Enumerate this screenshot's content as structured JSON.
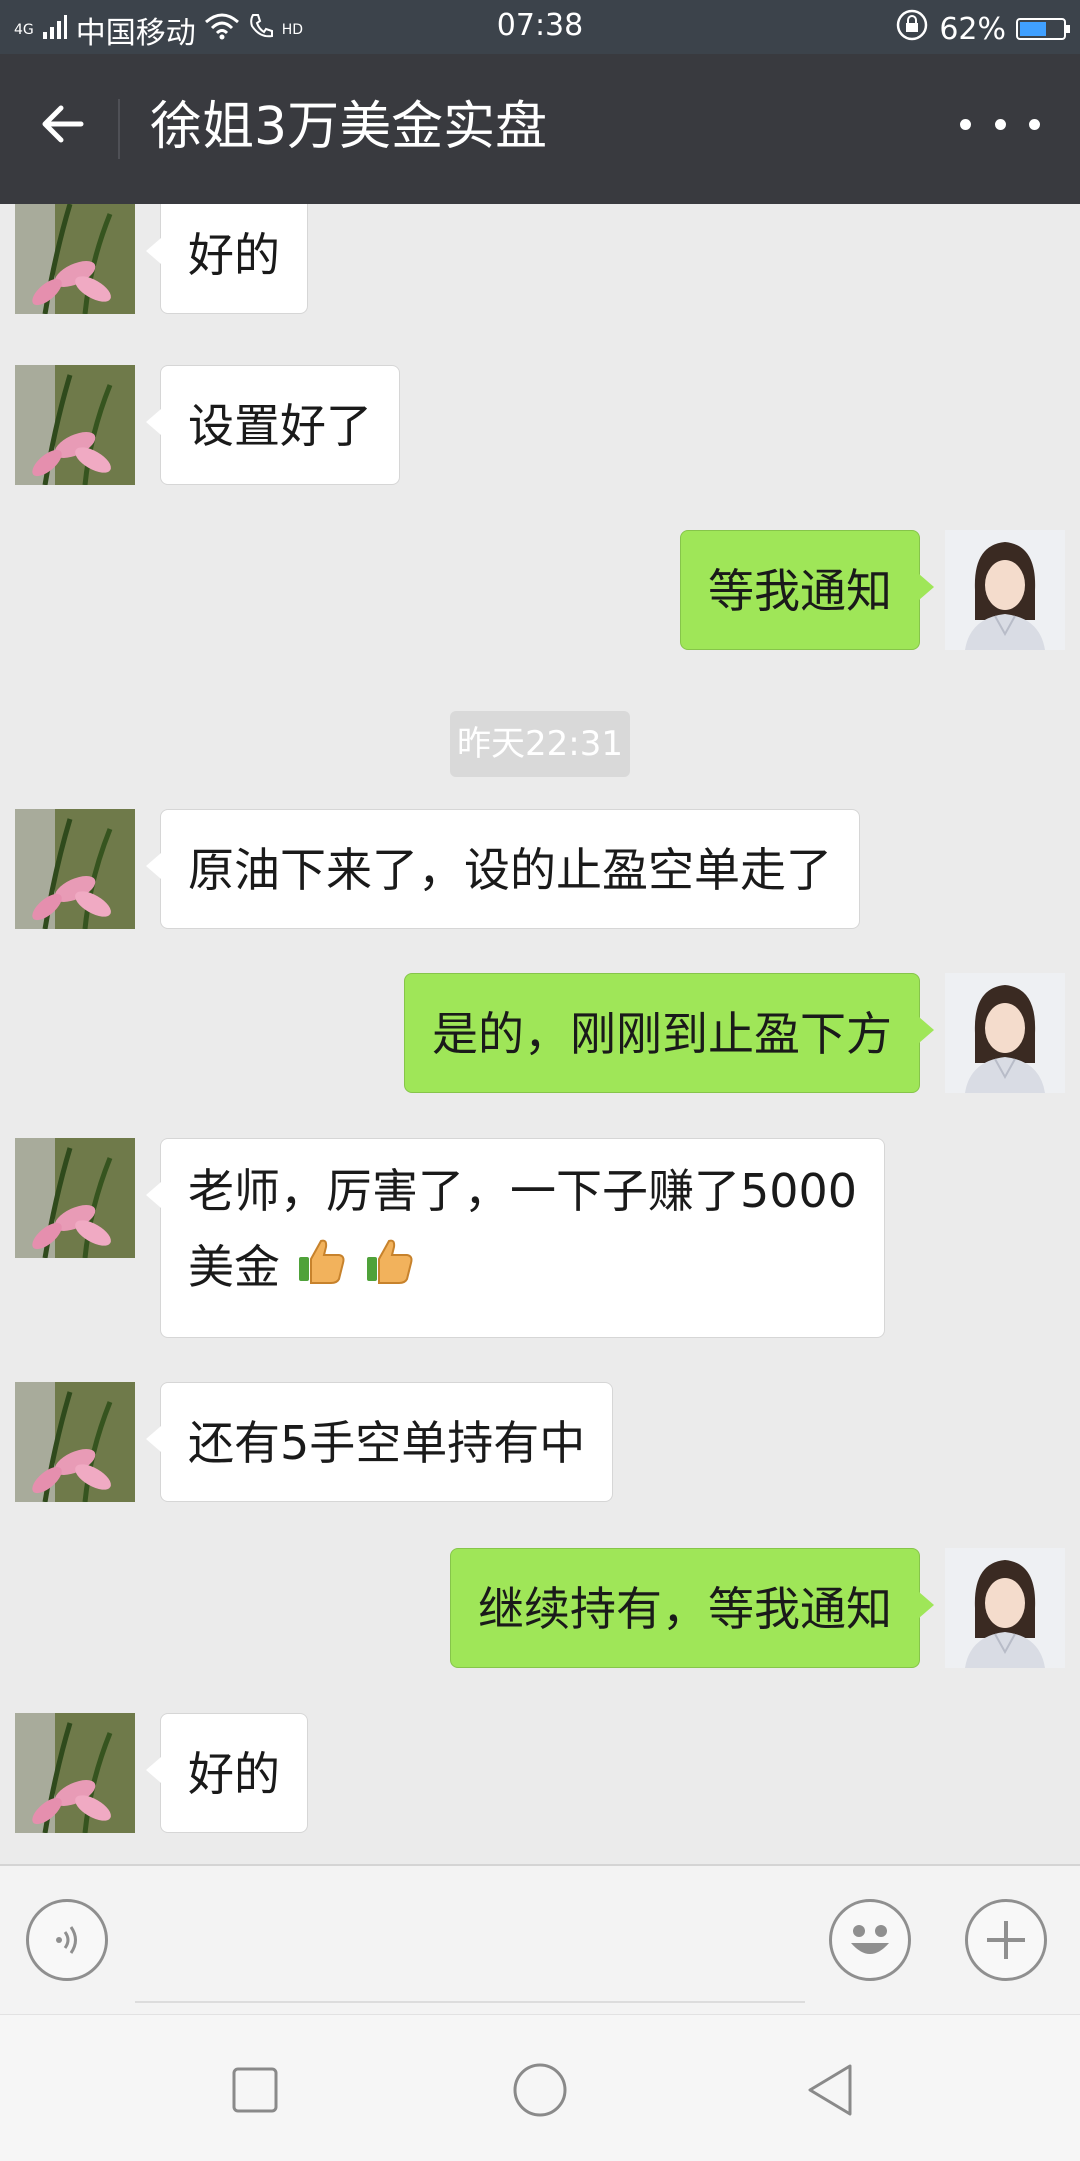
{
  "status_bar": {
    "network_label": "4G",
    "carrier": "中国移动",
    "hd_label": "HD",
    "time": "07:38",
    "battery_percent": "62%",
    "battery_level": 0.62
  },
  "header": {
    "title": "徐姐3万美金实盘"
  },
  "chat": {
    "timestamp": "昨天22:31",
    "messages": [
      {
        "direction": "in",
        "text": "好的"
      },
      {
        "direction": "in",
        "text": "设置好了"
      },
      {
        "direction": "out",
        "text": "等我通知"
      },
      {
        "direction": "in",
        "text": "原油下来了，设的止盈空单走了"
      },
      {
        "direction": "out",
        "text": "是的，刚刚到止盈下方"
      },
      {
        "direction": "in",
        "text_line1": "老师，厉害了，一下子赚了5000",
        "text_line2": "美金"
      },
      {
        "direction": "in",
        "text": "还有5手空单持有中"
      },
      {
        "direction": "out",
        "text": "继续持有，等我通知"
      },
      {
        "direction": "in",
        "text": "好的"
      }
    ]
  },
  "colors": {
    "title_bar": "#393a3f",
    "status_bar": "#3c434b",
    "out_bubble": "#9fe658",
    "in_bubble": "#ffffff",
    "chat_bg": "#ebebeb"
  },
  "icons": {
    "back": "arrow-left-icon",
    "more": "more-dots-icon",
    "voice": "voice-icon",
    "emoji": "emoji-icon",
    "plus": "plus-icon",
    "thumbs_up": "thumbs-up-icon"
  }
}
